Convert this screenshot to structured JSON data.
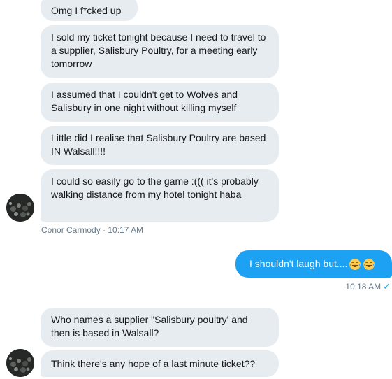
{
  "conversation": {
    "received_group_1": [
      "Omg I f*cked up",
      "I sold my ticket tonight because I need to travel to a supplier, Salisbury Poultry, for a meeting early tomorrow",
      "I assumed that I couldn't get to Wolves and Salisbury in one night without killing myself",
      "Little did I realise that Salisbury Poultry are based IN Walsall!!!!",
      "I could so easily go to the game :((( it's probably walking distance from my hotel tonight haba"
    ],
    "sender_meta": "Conor Carmody · 10:17 AM",
    "sent_message": {
      "text": "I shouldn't laugh but....",
      "emoji": [
        "face-with-tears-of-joy",
        "face-with-tears-of-joy"
      ],
      "time": "10:18 AM",
      "status_icon": "read-check-icon",
      "status_glyph": "✓"
    },
    "received_group_2": [
      "Who names a supplier \"Salisbury poultry' and then is based in Walsall?",
      "Think there's any hope of a last minute ticket??"
    ]
  },
  "colors": {
    "received_bubble": "#e6ecf0",
    "sent_bubble": "#1da1f2",
    "meta_text": "#657786",
    "text": "#14171a"
  }
}
